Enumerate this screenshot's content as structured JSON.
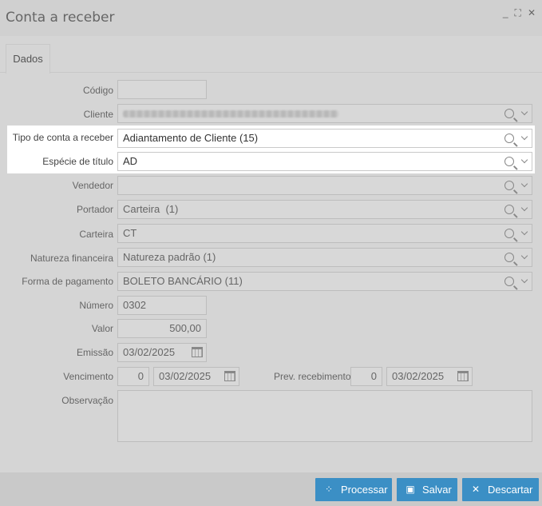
{
  "window": {
    "title": "Conta a receber",
    "minimize": "_",
    "maximize": "⛶",
    "close": "✕"
  },
  "tabs": [
    {
      "label": "Dados"
    }
  ],
  "form": {
    "codigo_label": "Código",
    "codigo_value": "",
    "cliente_label": "Cliente",
    "tipo_label": "Tipo de conta a receber",
    "tipo_value": "Adiantamento de Cliente (15)",
    "especie_label": "Espécie de título",
    "especie_value": "AD",
    "vendedor_label": "Vendedor",
    "vendedor_value": "",
    "portador_label": "Portador",
    "portador_value": "Carteira  (1)",
    "carteira_label": "Carteira",
    "carteira_value": "CT",
    "natureza_label": "Natureza financeira",
    "natureza_value": "Natureza padrão (1)",
    "forma_label": "Forma de pagamento",
    "forma_value": "BOLETO BANCÁRIO (11)",
    "numero_label": "Número",
    "numero_value": "0302",
    "valor_label": "Valor",
    "valor_value": "500,00",
    "emissao_label": "Emissão",
    "emissao_value": "03/02/2025",
    "vencimento_label": "Vencimento",
    "vencimento_days": "0",
    "vencimento_value": "03/02/2025",
    "prev_label": "Prev. recebimento",
    "prev_days": "0",
    "prev_value": "03/02/2025",
    "observacao_label": "Observação"
  },
  "buttons": {
    "processar": "Processar",
    "salvar": "Salvar",
    "descartar": "Descartar"
  }
}
